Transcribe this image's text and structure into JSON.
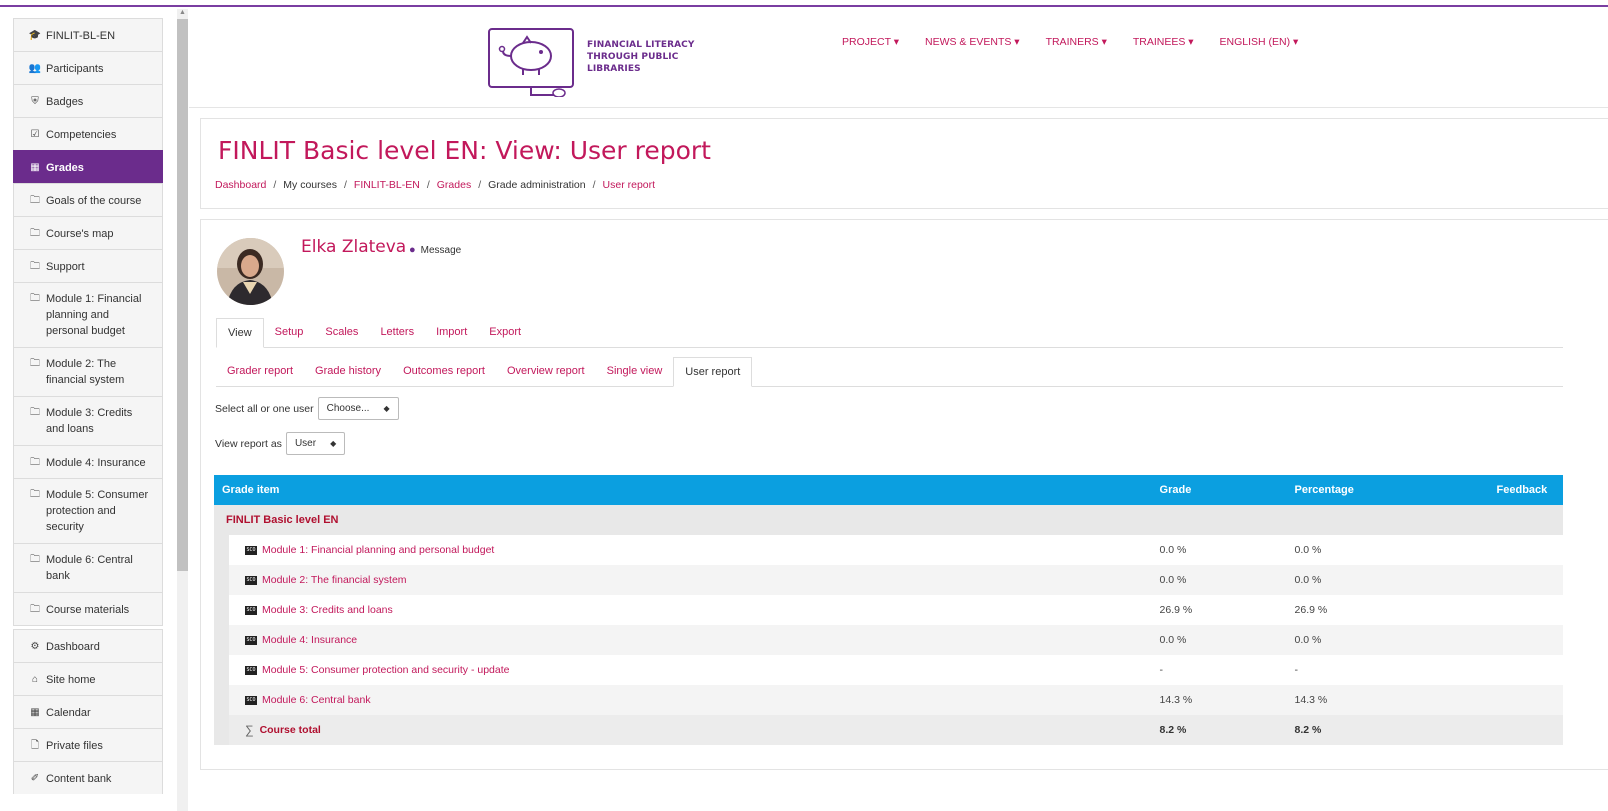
{
  "sidebar": {
    "items": [
      {
        "label": "FINLIT-BL-EN",
        "icon": "graduation-cap-icon",
        "glyph": "🎓"
      },
      {
        "label": "Participants",
        "icon": "users-icon",
        "glyph": "👥"
      },
      {
        "label": "Badges",
        "icon": "shield-icon",
        "glyph": "🛡"
      },
      {
        "label": "Competencies",
        "icon": "checkbox-icon",
        "glyph": "☑"
      },
      {
        "label": "Grades",
        "icon": "table-icon",
        "glyph": "▦"
      },
      {
        "label": "Goals of the course",
        "icon": "folder-icon",
        "glyph": "🗀"
      },
      {
        "label": "Course's map",
        "icon": "folder-icon",
        "glyph": "🗀"
      },
      {
        "label": "Support",
        "icon": "folder-icon",
        "glyph": "🗀"
      },
      {
        "label": "Module 1: Financial planning and personal budget",
        "icon": "folder-icon",
        "glyph": "🗀"
      },
      {
        "label": "Module 2: The financial system",
        "icon": "folder-icon",
        "glyph": "🗀"
      },
      {
        "label": "Module 3: Credits and loans",
        "icon": "folder-icon",
        "glyph": "🗀"
      },
      {
        "label": "Module 4: Insurance",
        "icon": "folder-icon",
        "glyph": "🗀"
      },
      {
        "label": "Module 5: Consumer protection and security",
        "icon": "folder-icon",
        "glyph": "🗀"
      },
      {
        "label": "Module 6: Central bank",
        "icon": "folder-icon",
        "glyph": "🗀"
      },
      {
        "label": "Course materials",
        "icon": "folder-icon",
        "glyph": "🗀"
      },
      {
        "label": "Dashboard",
        "icon": "dashboard-icon",
        "glyph": "⚙"
      },
      {
        "label": "Site home",
        "icon": "home-icon",
        "glyph": "⌂"
      },
      {
        "label": "Calendar",
        "icon": "calendar-icon",
        "glyph": "▦"
      },
      {
        "label": "Private files",
        "icon": "file-icon",
        "glyph": "🗋"
      },
      {
        "label": "Content bank",
        "icon": "brush-icon",
        "glyph": "✎"
      }
    ]
  },
  "header": {
    "logo_text": [
      "FINANCIAL LITERACY",
      "THROUGH PUBLIC",
      "LIBRARIES"
    ],
    "nav": [
      "PROJECT ▾",
      "NEWS & EVENTS ▾",
      "TRAINERS ▾",
      "TRAINEES ▾",
      "ENGLISH (EN) ▾"
    ]
  },
  "page": {
    "title": "FINLIT Basic level EN: View: User report",
    "breadcrumb": [
      {
        "label": "Dashboard",
        "link": true
      },
      {
        "label": "My courses",
        "link": false
      },
      {
        "label": "FINLIT-BL-EN",
        "link": true
      },
      {
        "label": "Grades",
        "link": true
      },
      {
        "label": "Grade administration",
        "link": false
      },
      {
        "label": "User report",
        "link": true
      }
    ]
  },
  "user": {
    "name": "Elka Zlateva",
    "message_label": "Message"
  },
  "tabs_primary": [
    "View",
    "Setup",
    "Scales",
    "Letters",
    "Import",
    "Export"
  ],
  "tabs_secondary": [
    "Grader report",
    "Grade history",
    "Outcomes report",
    "Overview report",
    "Single view",
    "User report"
  ],
  "controls": {
    "select_user_label": "Select all or one user",
    "select_user_value": "Choose...",
    "view_as_label": "View report as",
    "view_as_value": "User"
  },
  "table": {
    "headers": {
      "item": "Grade item",
      "grade": "Grade",
      "percentage": "Percentage",
      "feedback": "Feedback"
    },
    "category": "FINLIT Basic level EN",
    "rows": [
      {
        "name": "Module 1: Financial planning and personal budget",
        "grade": "0.0 %",
        "percentage": "0.0 %"
      },
      {
        "name": "Module 2: The financial system",
        "grade": "0.0 %",
        "percentage": "0.0 %"
      },
      {
        "name": "Module 3: Credits and loans",
        "grade": "26.9 %",
        "percentage": "26.9 %"
      },
      {
        "name": "Module 4: Insurance",
        "grade": "0.0 %",
        "percentage": "0.0 %"
      },
      {
        "name": "Module 5: Consumer protection and security - update",
        "grade": "-",
        "percentage": "-"
      },
      {
        "name": "Module 6: Central bank",
        "grade": "14.3 %",
        "percentage": "14.3 %"
      }
    ],
    "total": {
      "name": "Course total",
      "grade": "8.2 %",
      "percentage": "8.2 %"
    }
  }
}
